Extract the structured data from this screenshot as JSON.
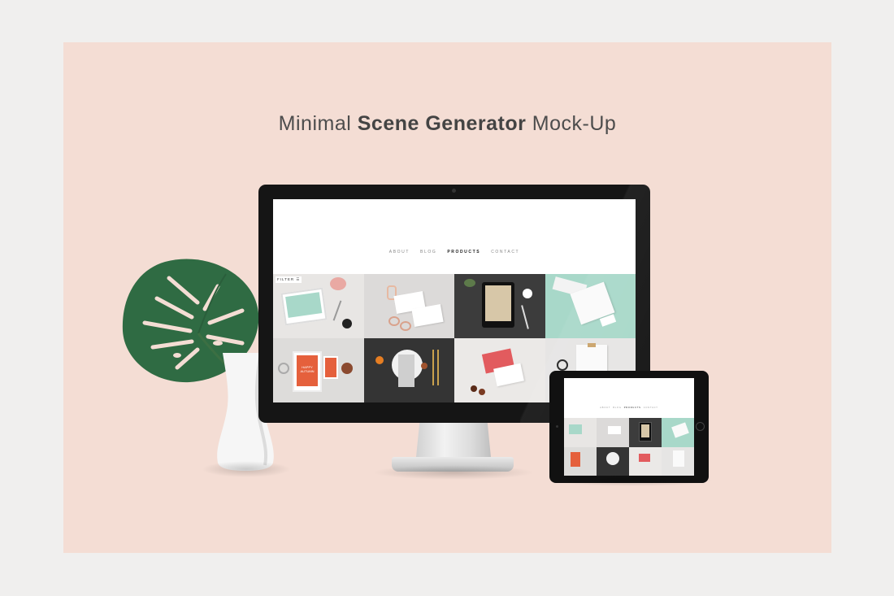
{
  "title": {
    "light_1": "Minimal",
    "bold": "Scene Generator",
    "light_2": "Mock-Up"
  },
  "site": {
    "nav": [
      "ABOUT",
      "BLOG",
      "PRODUCTS",
      "CONTACT"
    ],
    "active_nav": "PRODUCTS",
    "filter_label": "FILTER ☰"
  },
  "colors": {
    "background": "#f4ddd4",
    "outer": "#f0efee",
    "mint": "#a8d8c9",
    "orange": "#e5603c",
    "coral": "#e25b5e",
    "dark": "#3a3a3a"
  },
  "tiles": [
    {
      "name": "tile-tablet-mint-desk",
      "bg": "#e8e6e4"
    },
    {
      "name": "tile-cards-sunglasses",
      "bg": "#dcdad9"
    },
    {
      "name": "tile-dark-tablet",
      "bg": "#3c3c3c"
    },
    {
      "name": "tile-mint-stationery",
      "bg": "#a8d8c9"
    },
    {
      "name": "tile-autumn-frames",
      "bg": "#dddcda"
    },
    {
      "name": "tile-dark-table-setting",
      "bg": "#343434"
    },
    {
      "name": "tile-envelope-chocolates",
      "bg": "#ebe9e7"
    },
    {
      "name": "tile-clipboard-scissors",
      "bg": "#e6e5e4"
    }
  ],
  "tile_art": {
    "autumn_text": "HAPPY AUTUMN"
  }
}
